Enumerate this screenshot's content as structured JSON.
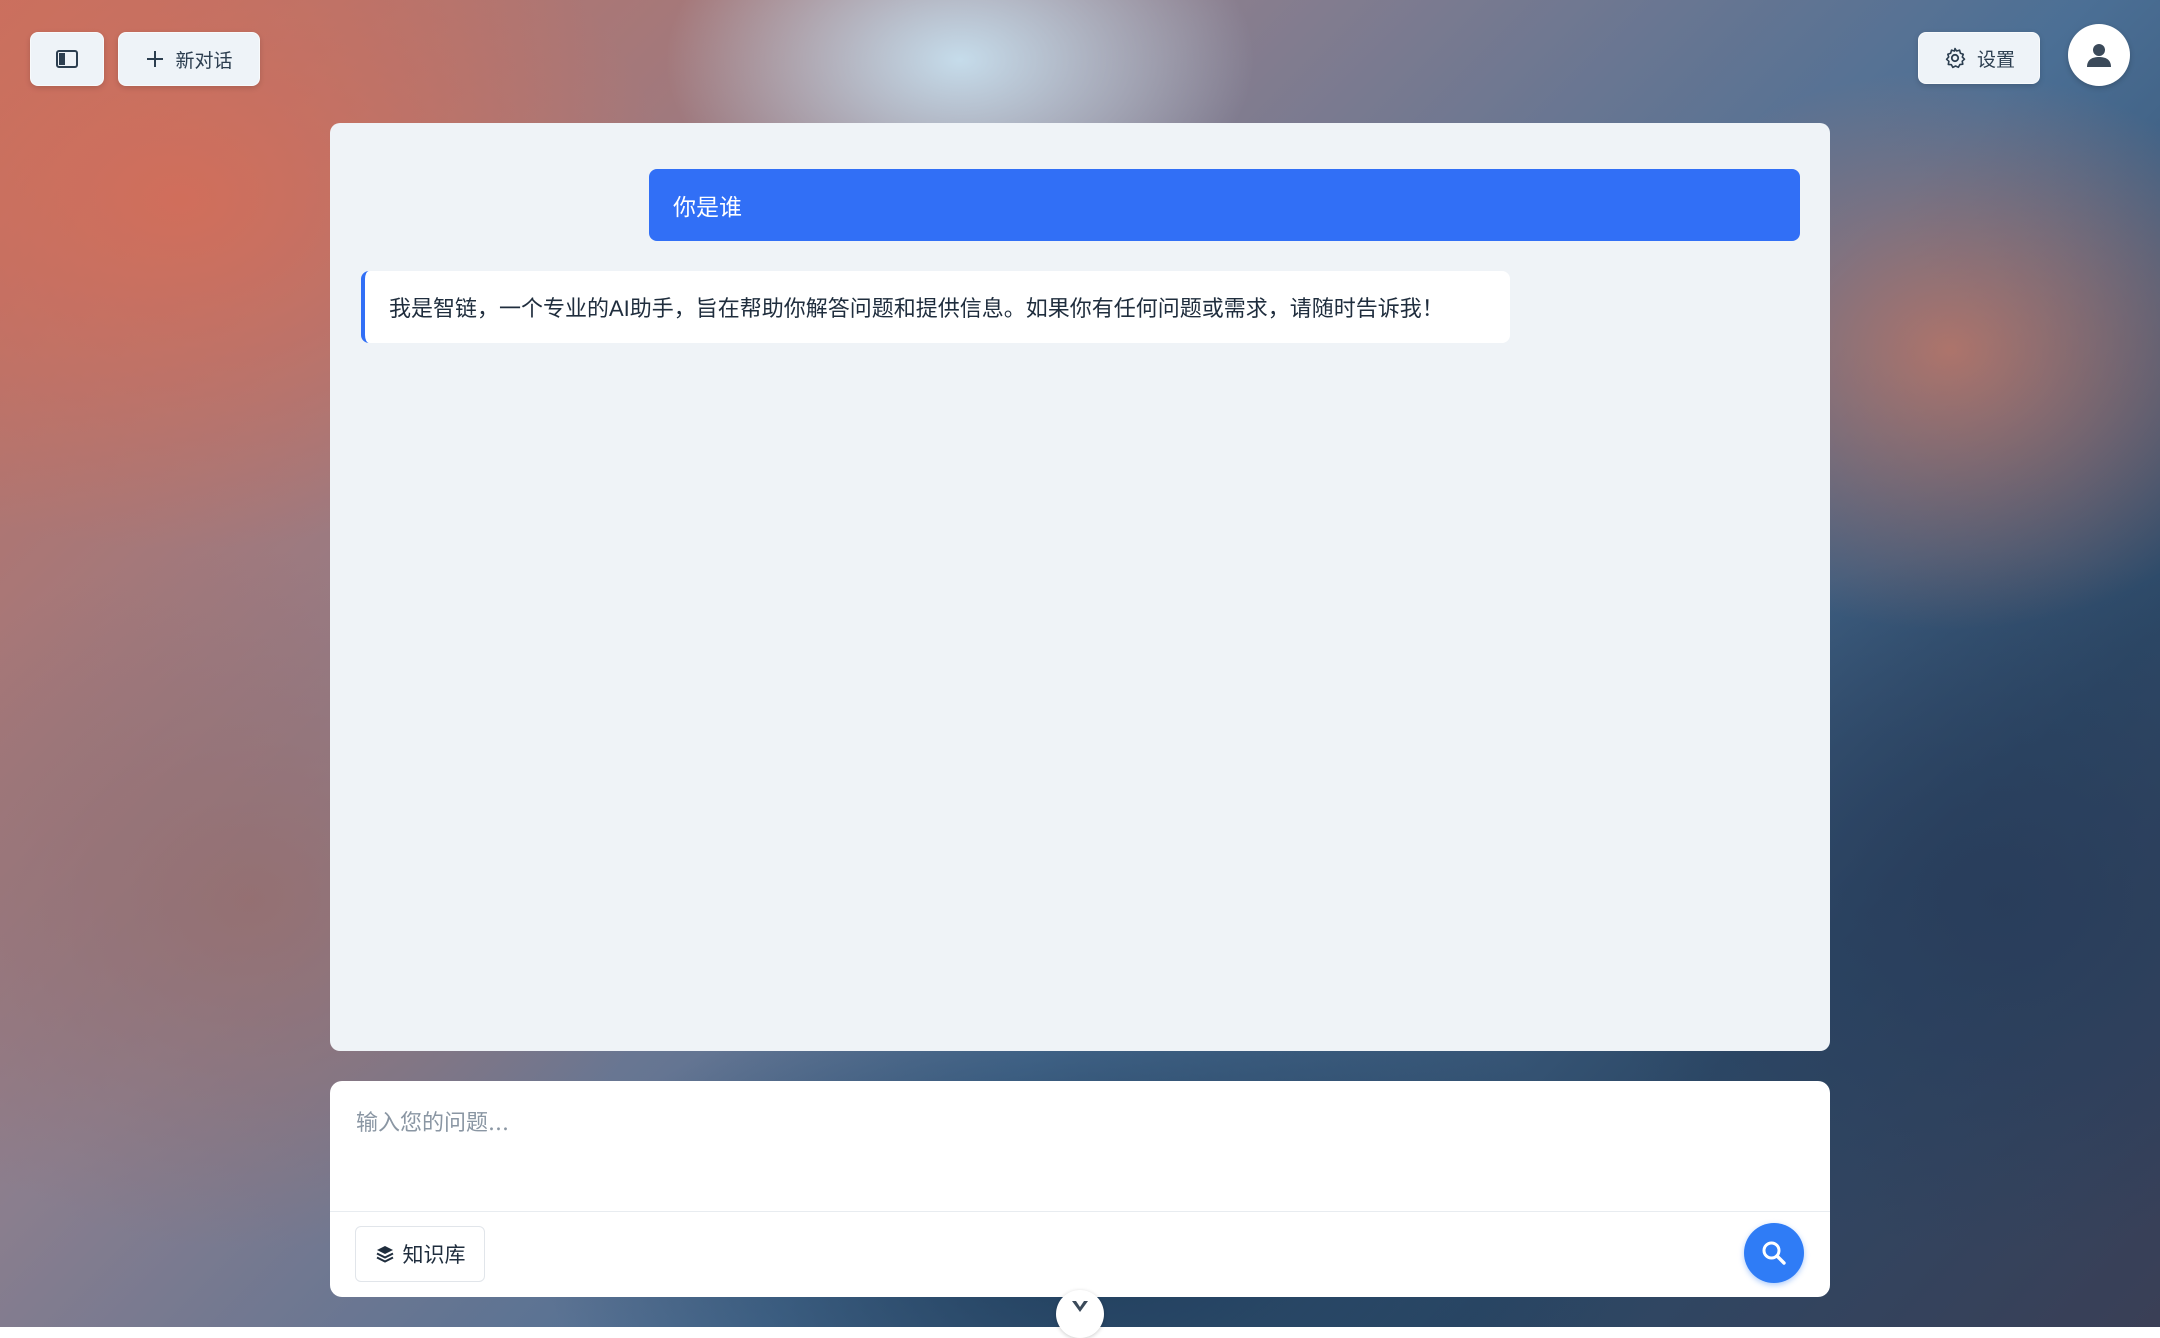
{
  "header": {
    "sidebar_toggle_icon": "sidebar-toggle-icon",
    "new_chat_label": "新对话",
    "settings_label": "设置",
    "avatar_icon": "user-icon"
  },
  "chat": {
    "messages": [
      {
        "role": "user",
        "text": "你是谁"
      },
      {
        "role": "assistant",
        "text": "我是智链，一个专业的AI助手，旨在帮助你解答问题和提供信息。如果你有任何问题或需求，请随时告诉我！"
      }
    ]
  },
  "composer": {
    "placeholder": "输入您的问题...",
    "value": "",
    "knowledge_base_label": "知识库",
    "search_icon": "search-icon"
  },
  "colors": {
    "accent": "#316ff6",
    "panel_bg": "#eff3f7"
  }
}
